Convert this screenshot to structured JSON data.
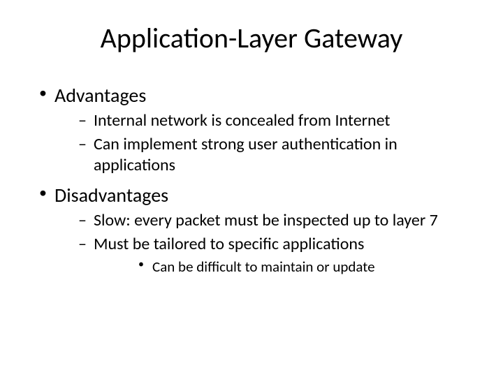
{
  "title": "Application-Layer Gateway",
  "sections": [
    {
      "heading": "Advantages",
      "items": [
        {
          "text": "Internal network is concealed from Internet"
        },
        {
          "text": "Can implement strong user authentication in applications"
        }
      ]
    },
    {
      "heading": "Disadvantages",
      "items": [
        {
          "text": "Slow: every packet must be inspected up to layer 7"
        },
        {
          "text": "Must be tailored to specific applications",
          "subitems": [
            {
              "text": "Can be difficult to maintain or update"
            }
          ]
        }
      ]
    }
  ]
}
